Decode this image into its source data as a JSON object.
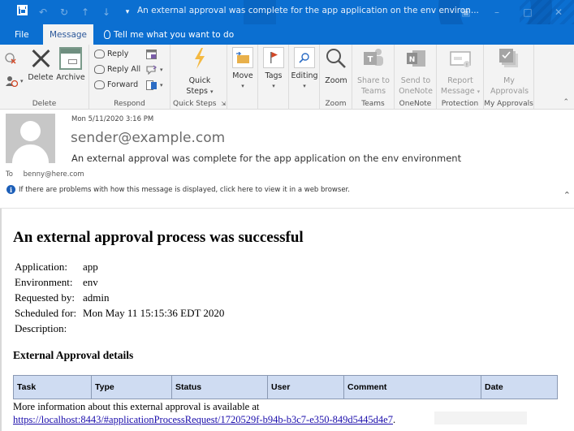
{
  "window": {
    "title": "An external approval was complete for the app application on the env environ...",
    "controls": [
      "restore-ribbon",
      "minimize",
      "maximize",
      "close"
    ]
  },
  "quick_access": {
    "icons": [
      "save-icon",
      "undo-icon",
      "redo-icon",
      "up-icon",
      "down-icon",
      "customize-icon"
    ]
  },
  "tabs": {
    "file": "File",
    "message": "Message",
    "tell_me": "Tell me what you want to do"
  },
  "ribbon": {
    "delete_group": {
      "label": "Delete",
      "delete": "Delete",
      "archive": "Archive"
    },
    "respond_group": {
      "label": "Respond",
      "reply": "Reply",
      "reply_all": "Reply All",
      "forward": "Forward"
    },
    "quick_steps_group": {
      "label": "Quick Steps",
      "quick": "Quick",
      "steps": "Steps"
    },
    "move": "Move",
    "tags": "Tags",
    "editing": "Editing",
    "zoom_group": {
      "label": "Zoom",
      "zoom": "Zoom"
    },
    "teams_group": {
      "label": "Teams",
      "line1": "Share to",
      "line2": "Teams"
    },
    "onenote_group": {
      "label": "OneNote",
      "line1": "Send to",
      "line2": "OneNote"
    },
    "protection_group": {
      "label": "Protection",
      "line1": "Report",
      "line2": "Message"
    },
    "approvals_group": {
      "label": "My Approvals",
      "line1": "My",
      "line2": "Approvals"
    }
  },
  "message": {
    "datetime": "Mon 5/11/2020 3:16 PM",
    "sender": "sender@example.com",
    "subject": "An external approval was complete for the app application on the env environment",
    "to_label": "To",
    "to": "benny@here.com",
    "info_bar": "If there are problems with how this message is displayed, click here to view it in a web browser."
  },
  "body": {
    "heading": "An external approval process was successful",
    "fields": [
      {
        "key": "Application:",
        "value": "app"
      },
      {
        "key": "Environment:",
        "value": "env"
      },
      {
        "key": "Requested by:",
        "value": "admin"
      },
      {
        "key": "Scheduled for:",
        "value": "Mon May 11 15:15:36 EDT 2020"
      },
      {
        "key": "Description:",
        "value": ""
      }
    ],
    "details_heading": "External Approval details",
    "table_headers": [
      "Task",
      "Type",
      "Status",
      "User",
      "Comment",
      "Date"
    ],
    "more_info": "More information about this external approval is available at",
    "link": "https://localhost:8443/#applicationProcessRequest/1720529f-b94b-b3c7-e350-849d5445d4e7",
    "link_suffix": "."
  },
  "colors": {
    "titlebar": "#0b6fd1",
    "ribbon_bg": "#f3f3f3",
    "table_header_bg": "#cfdcf2",
    "link": "#1a0dab"
  }
}
